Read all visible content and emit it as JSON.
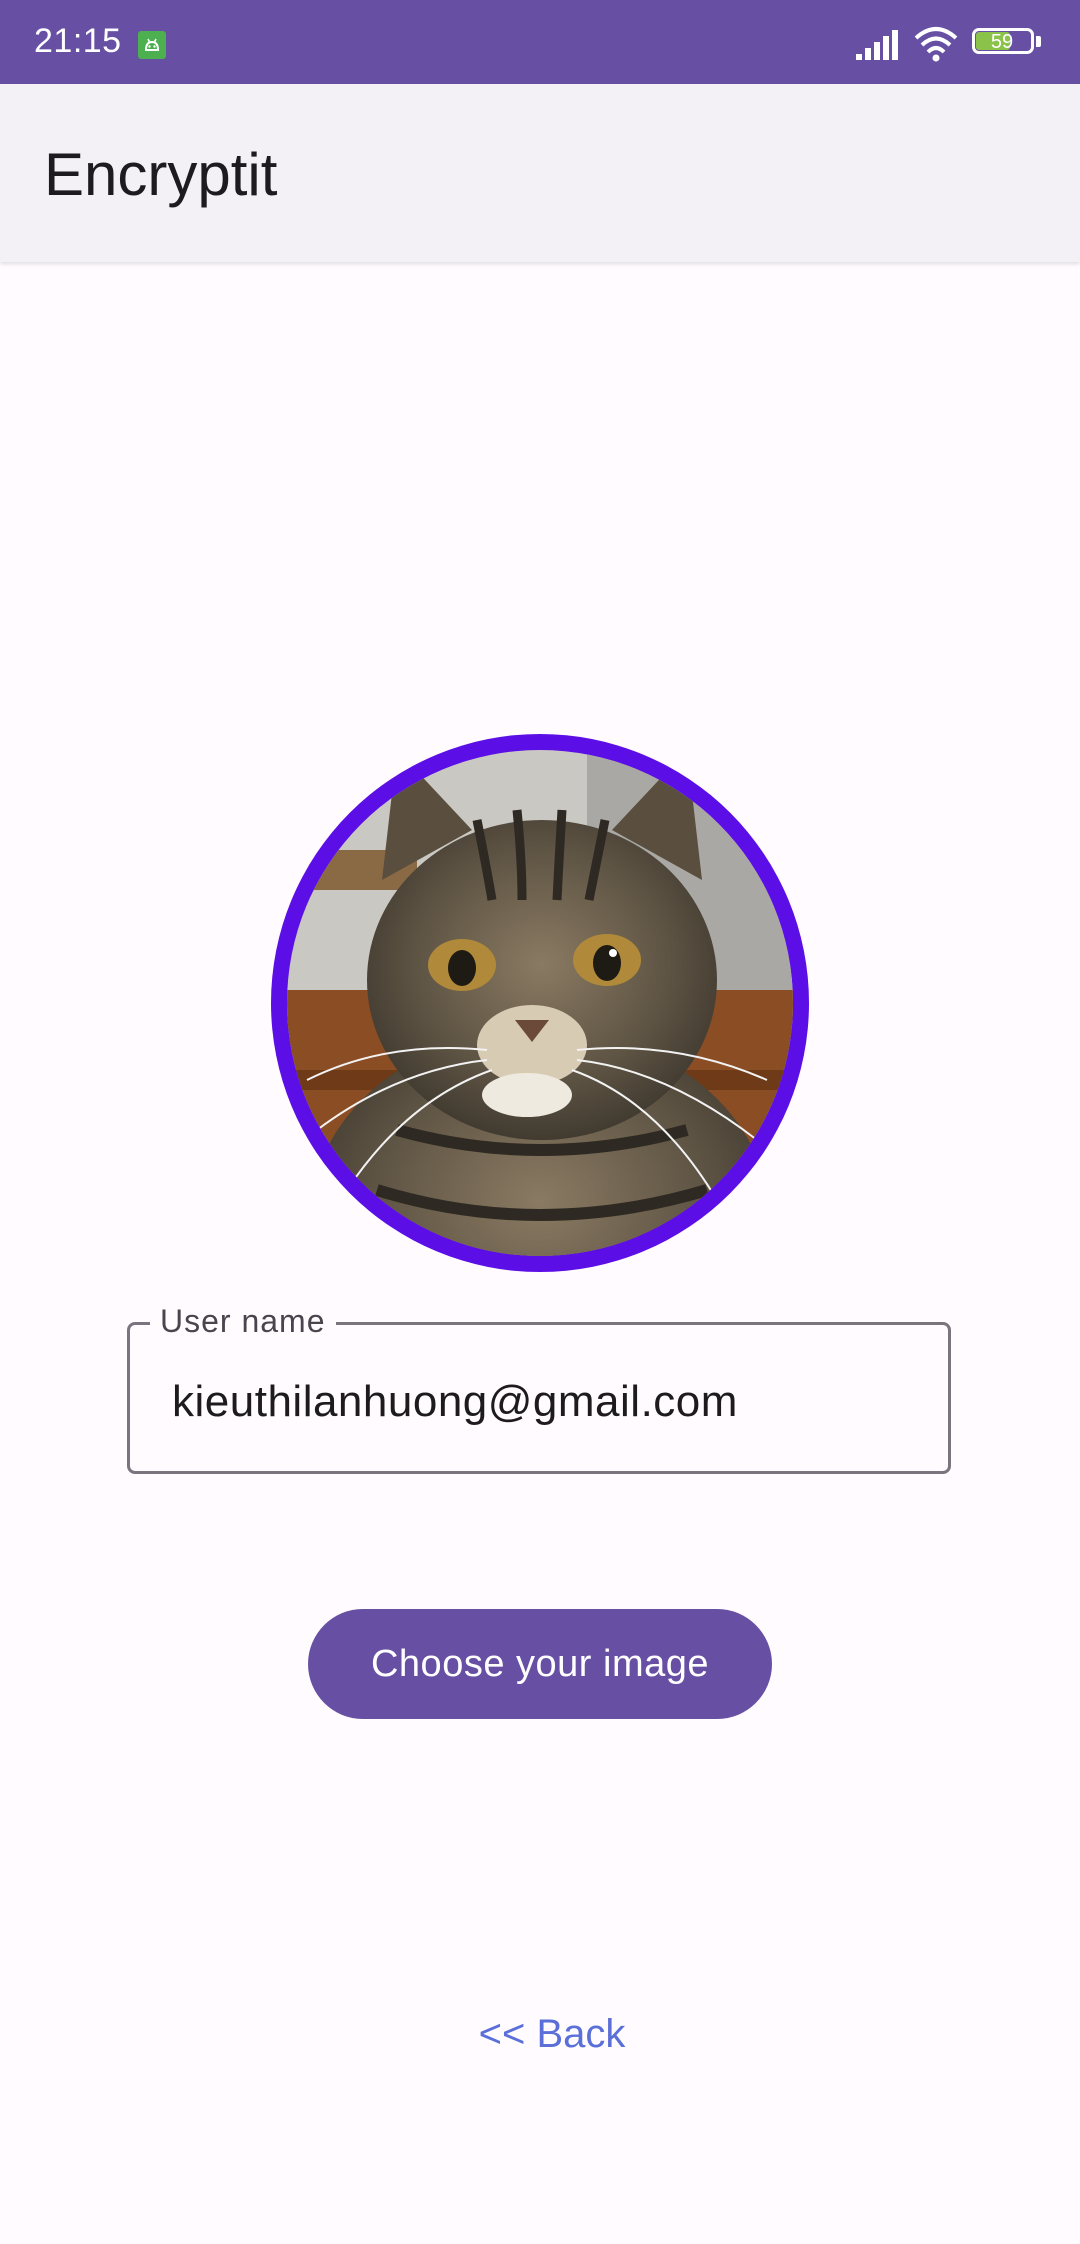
{
  "status_bar": {
    "time": "21:15",
    "battery_level": "59",
    "icons": [
      "android-notification-icon",
      "signal-icon",
      "wifi-icon",
      "battery-icon"
    ]
  },
  "app_bar": {
    "title": "Encryptit"
  },
  "avatar": {
    "image": "cat-photo",
    "border_color": "#5b0ee6"
  },
  "username_field": {
    "label": "User name",
    "value": "kieuthilanhuong@gmail.com"
  },
  "choose_button": {
    "label": "Choose your image"
  },
  "back_link": {
    "label": "<< Back"
  },
  "colors": {
    "primary": "#6750a4",
    "link": "#5b6fd8",
    "background": "#fffbfe"
  }
}
